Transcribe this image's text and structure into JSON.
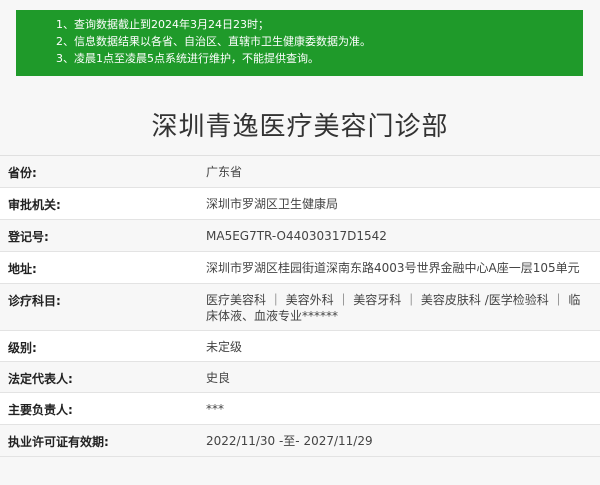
{
  "notice": {
    "lines": [
      "1、查询数据截止到2024年3月24日23时；",
      "2、信息数据结果以各省、自治区、直辖市卫生健康委数据为准。",
      "3、凌晨1点至凌晨5点系统进行维护，不能提供查询。"
    ]
  },
  "page_title": "深圳青逸医疗美容门诊部",
  "rows": [
    {
      "label": "省份:",
      "value": "广东省"
    },
    {
      "label": "审批机关:",
      "value": "深圳市罗湖区卫生健康局"
    },
    {
      "label": "登记号:",
      "value": "MA5EG7TR-O44030317D1542"
    },
    {
      "label": "地址:",
      "value": "深圳市罗湖区桂园街道深南东路4003号世界金融中心A座一层105单元"
    },
    {
      "label": "诊疗科目:",
      "value": "医疗美容科 ｜ 美容外科 ｜ 美容牙科 ｜ 美容皮肤科 /医学检验科 ｜ 临床体液、血液专业******"
    },
    {
      "label": "级别:",
      "value": "未定级"
    },
    {
      "label": "法定代表人:",
      "value": "史良"
    },
    {
      "label": "主要负责人:",
      "value": "***"
    },
    {
      "label": "执业许可证有效期:",
      "value": "2022/11/30 -至- 2027/11/29"
    }
  ]
}
